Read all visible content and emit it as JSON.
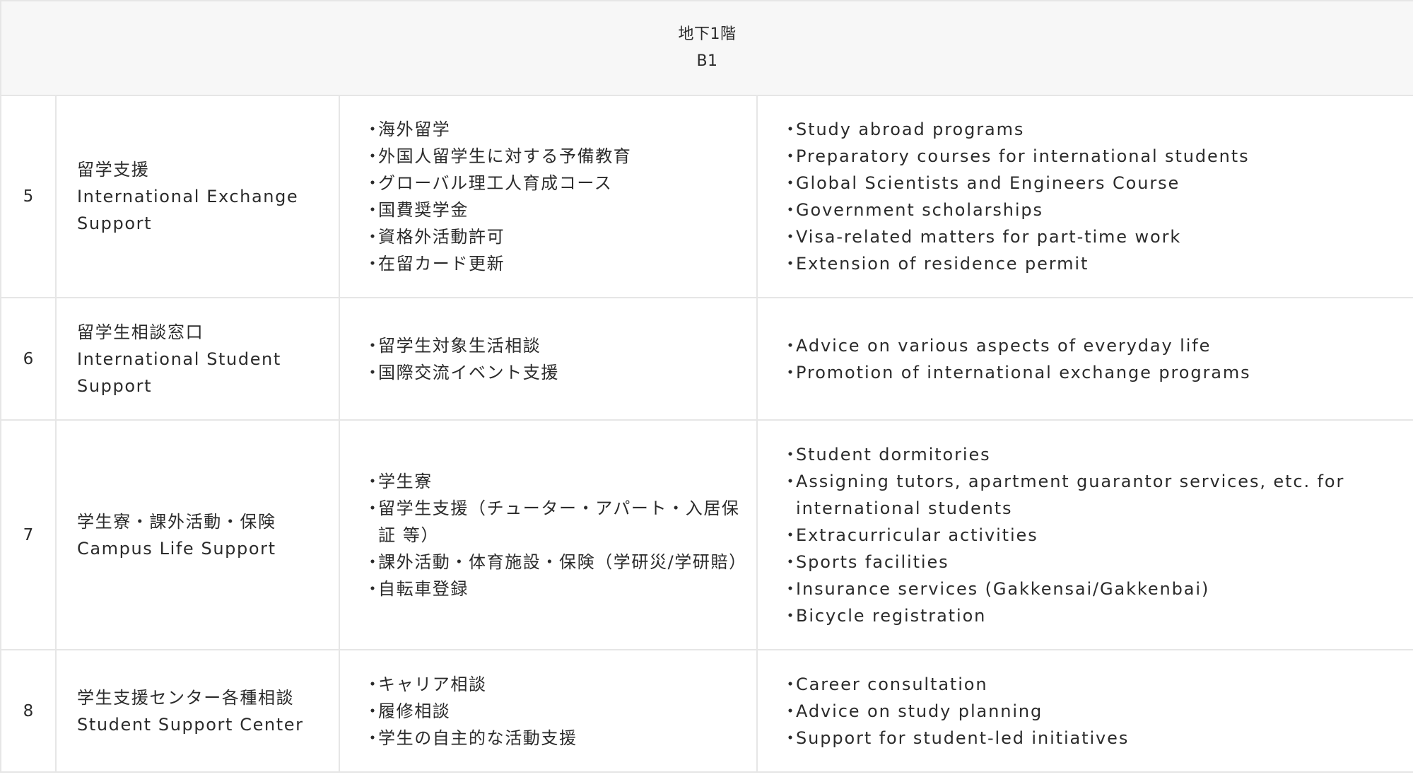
{
  "floor": {
    "ja": "地下1階",
    "en": "B1"
  },
  "rows": [
    {
      "number": "5",
      "name_ja": "留学支援",
      "name_en": "International Exchange Support",
      "services_ja": [
        "海外留学",
        "外国人留学生に対する予備教育",
        "グローバル理工人育成コース",
        "国費奨学金",
        "資格外活動許可",
        "在留カード更新"
      ],
      "services_en": [
        "Study abroad programs",
        "Preparatory courses for international students",
        "Global Scientists and Engineers Course",
        "Government scholarships",
        "Visa-related matters for part-time work",
        "Extension of residence permit"
      ]
    },
    {
      "number": "6",
      "name_ja": "留学生相談窓口",
      "name_en": "International Student Support",
      "services_ja": [
        "留学生対象生活相談",
        "国際交流イベント支援"
      ],
      "services_en": [
        "Advice on various aspects of everyday life",
        "Promotion of international exchange programs"
      ]
    },
    {
      "number": "7",
      "name_ja": "学生寮・課外活動・保険",
      "name_en": "Campus Life Support",
      "services_ja": [
        "学生寮",
        "留学生支援（チューター・アパート・入居保証 等）",
        "課外活動・体育施設・保険（学研災/学研賠）",
        "自転車登録"
      ],
      "services_en": [
        "Student dormitories",
        "Assigning tutors, apartment guarantor services, etc. for international students",
        "Extracurricular activities",
        "Sports facilities",
        "Insurance services (Gakkensai/Gakkenbai)",
        "Bicycle registration"
      ]
    },
    {
      "number": "8",
      "name_ja": "学生支援センター各種相談",
      "name_en": "Student Support Center",
      "services_ja": [
        "キャリア相談",
        "履修相談",
        "学生の自主的な活動支援"
      ],
      "services_en": [
        "Career consultation",
        "Advice on study planning",
        "Support for student-led initiatives"
      ]
    }
  ],
  "bullet": "・",
  "colors": {
    "border": "#e6e6e6",
    "floor_bg": "#f7f7f7",
    "text": "#2b2b2b"
  }
}
